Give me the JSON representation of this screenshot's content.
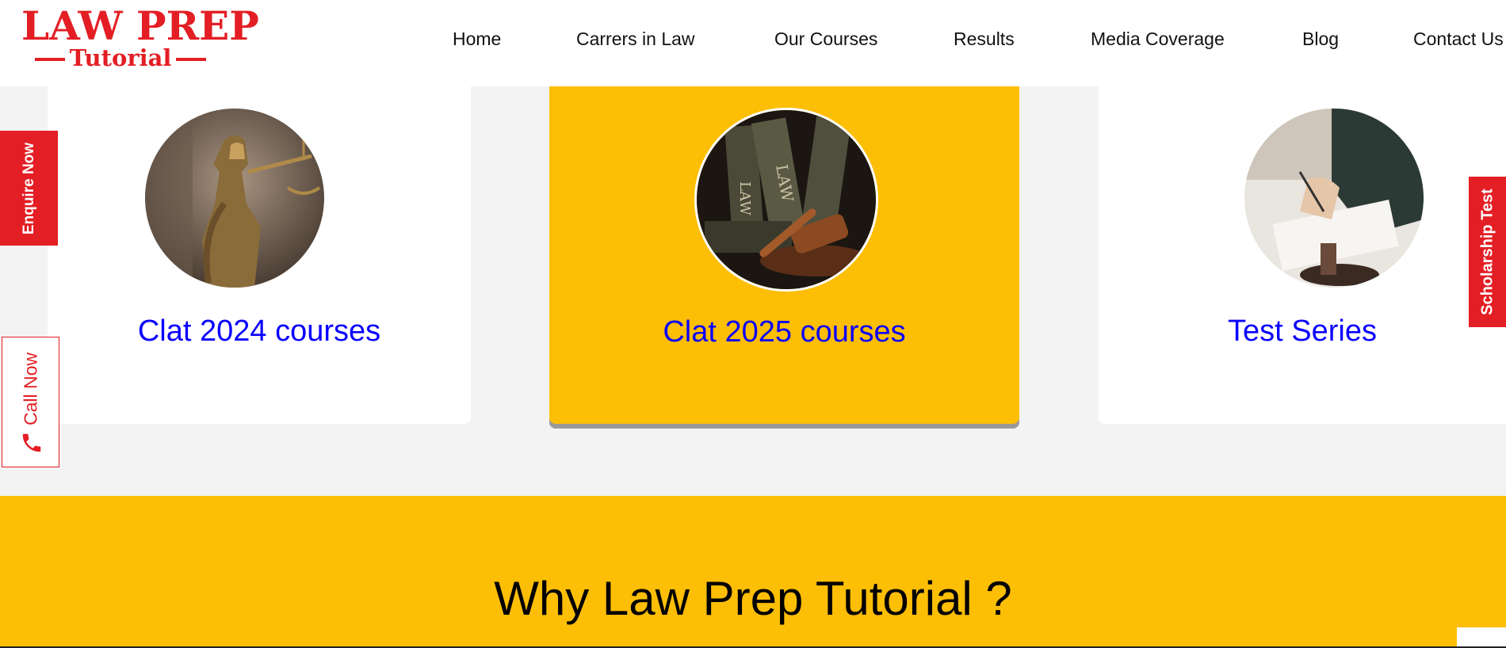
{
  "brand": {
    "logo_line1": "LAW PREP",
    "logo_line2": "Tutorial",
    "color": "#e31e24"
  },
  "nav": {
    "items": [
      "Home",
      "Carrers in Law",
      "Our Courses",
      "Results",
      "Media Coverage",
      "Blog",
      "Contact Us"
    ]
  },
  "courses": [
    {
      "title": "Clat 2024 courses",
      "image": "lady-justice-statue-icon"
    },
    {
      "title": "Clat 2025 courses",
      "image": "law-books-gavel-icon",
      "active": true
    },
    {
      "title": "Test Series",
      "image": "lawyer-writing-gavel-icon"
    }
  ],
  "side_tabs": {
    "enquire": "Enquire Now",
    "call": "Call Now",
    "scholarship": "Scholarship Test"
  },
  "why": {
    "title": "Why Law Prep Tutorial ?"
  },
  "colors": {
    "accent_yellow": "#fdbe06",
    "brand_red": "#e31e24",
    "link_blue": "#0a00ff"
  }
}
